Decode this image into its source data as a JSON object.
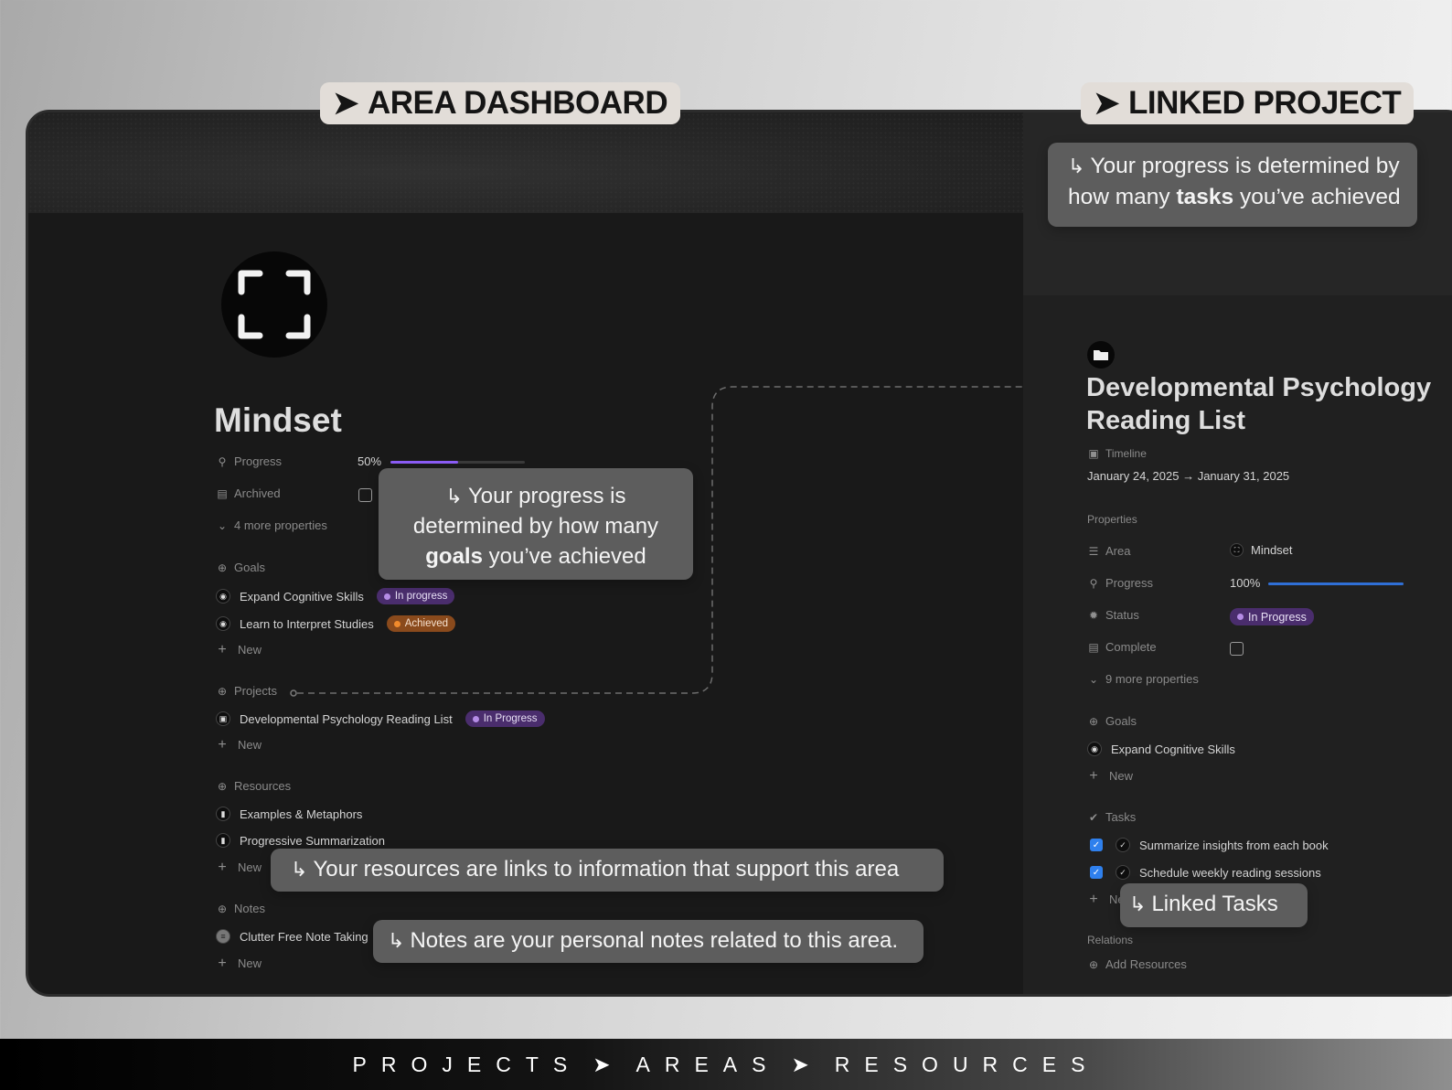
{
  "pills": {
    "left": {
      "arrow": "➤",
      "label": "AREA DASHBOARD"
    },
    "right": {
      "arrow": "➤",
      "label": "LINKED PROJECT"
    }
  },
  "callouts": {
    "right_top": {
      "hook": "↳",
      "pre": "Your progress is determined by how many ",
      "bold": "tasks",
      "post": " you’ve achieved"
    },
    "goals": {
      "hook": "↳",
      "pre": "Your progress is determined by how many ",
      "bold": "goals",
      "post": " you’ve achieved"
    },
    "resources": {
      "hook": "↳",
      "text": "Your resources are links to information that support this area"
    },
    "notes": {
      "hook": "↳",
      "text": "Notes are your personal notes related to this area."
    },
    "tasks": {
      "hook": "↳",
      "text": "Linked Tasks"
    }
  },
  "area": {
    "title": "Mindset",
    "properties": {
      "progress_label": "Progress",
      "progress_value": "50%",
      "progress_fraction": 0.5,
      "archived_label": "Archived",
      "more": "4 more properties"
    },
    "goals": {
      "header": "Goals",
      "items": [
        {
          "label": "Expand Cognitive Skills",
          "status": "In progress",
          "status_color": "#b58ce6"
        },
        {
          "label": "Learn to Interpret Studies",
          "status": "Achieved",
          "status_color": "#f08a2c"
        }
      ],
      "new": "New"
    },
    "projects": {
      "header": "Projects",
      "items": [
        {
          "label": "Developmental Psychology Reading List",
          "status": "In Progress"
        }
      ],
      "new": "New"
    },
    "resources": {
      "header": "Resources",
      "items": [
        {
          "label": "Examples & Metaphors"
        },
        {
          "label": "Progressive Summarization"
        }
      ],
      "new": "New"
    },
    "notes": {
      "header": "Notes",
      "items": [
        {
          "label": "Clutter Free Note Taking"
        }
      ],
      "new": "New"
    }
  },
  "project": {
    "title_line1": "Developmental Psychology",
    "title_line2": "Reading List",
    "timeline_label": "Timeline",
    "timeline_value": "January 24, 2025 → January 31, 2025",
    "properties_header": "Properties",
    "area_label": "Area",
    "area_value": "Mindset",
    "progress_label": "Progress",
    "progress_value": "100%",
    "progress_fraction": 1.0,
    "status_label": "Status",
    "status_value": "In Progress",
    "complete_label": "Complete",
    "more": "9 more properties",
    "goals_header": "Goals",
    "goals_items": [
      {
        "label": "Expand Cognitive Skills"
      }
    ],
    "goals_new": "New",
    "tasks_header": "Tasks",
    "tasks_items": [
      {
        "label": "Summarize insights from each book"
      },
      {
        "label": "Schedule weekly reading sessions"
      }
    ],
    "tasks_new": "New",
    "relations_header": "Relations",
    "add_resources": "Add Resources"
  },
  "footer": {
    "item1": "PROJECTS",
    "sep1": "➤",
    "item2": "AREAS",
    "sep2": "➤",
    "item3": "RESOURCES"
  },
  "colors": {
    "accent_purple": "#8b5cf6",
    "progress_blue": "#2f6fd6",
    "panel_bg": "#191919"
  }
}
